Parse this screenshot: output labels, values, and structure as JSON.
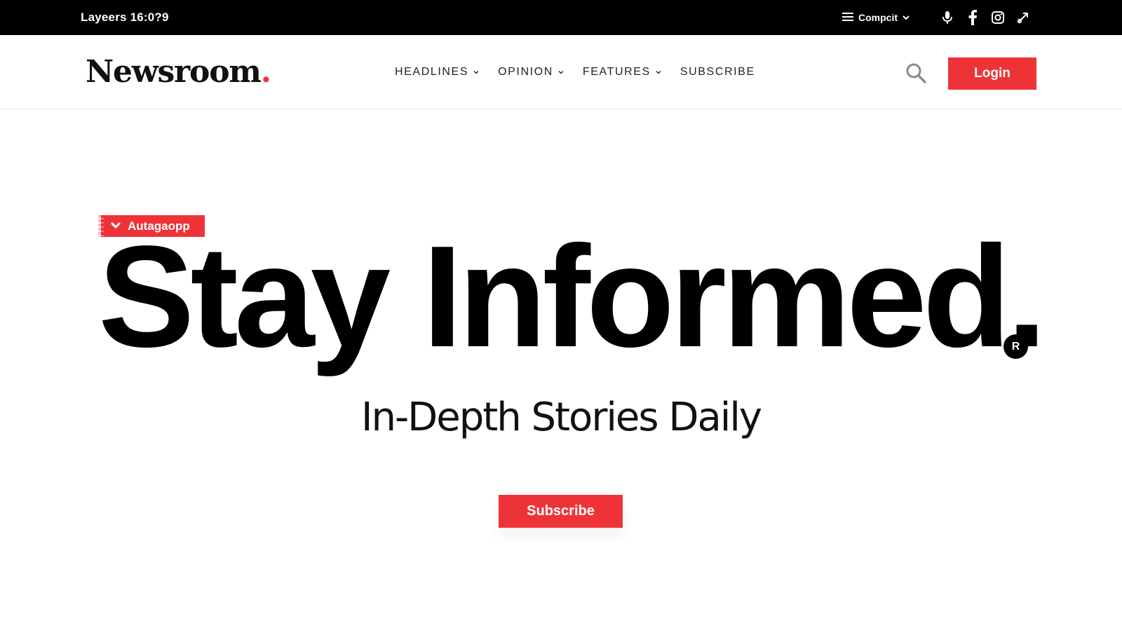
{
  "topbar": {
    "title": "Layeers 16:0?9",
    "menu_label": "Compcit",
    "icons": [
      "hamburger-icon",
      "chevron-down-icon",
      "microphone-icon",
      "facebook-icon",
      "instagram-icon",
      "share-icon"
    ]
  },
  "header": {
    "logo": "Newsroom",
    "logo_dot": ".",
    "nav": [
      {
        "label": "HEADLINES",
        "has_dropdown": true
      },
      {
        "label": "OPINION",
        "has_dropdown": true
      },
      {
        "label": "FEATURES",
        "has_dropdown": true
      },
      {
        "label": "SUBSCRIBE",
        "has_dropdown": false
      }
    ],
    "login_label": "Login"
  },
  "hero": {
    "tag_label": "Autagaopp",
    "title": "Stay Informed.",
    "reg_mark": "R",
    "subtitle": "In-Depth Stories Daily",
    "cta_label": "Subscribe"
  },
  "colors": {
    "accent": "#ee3338",
    "topbar_bg": "#000000",
    "text": "#111111"
  }
}
